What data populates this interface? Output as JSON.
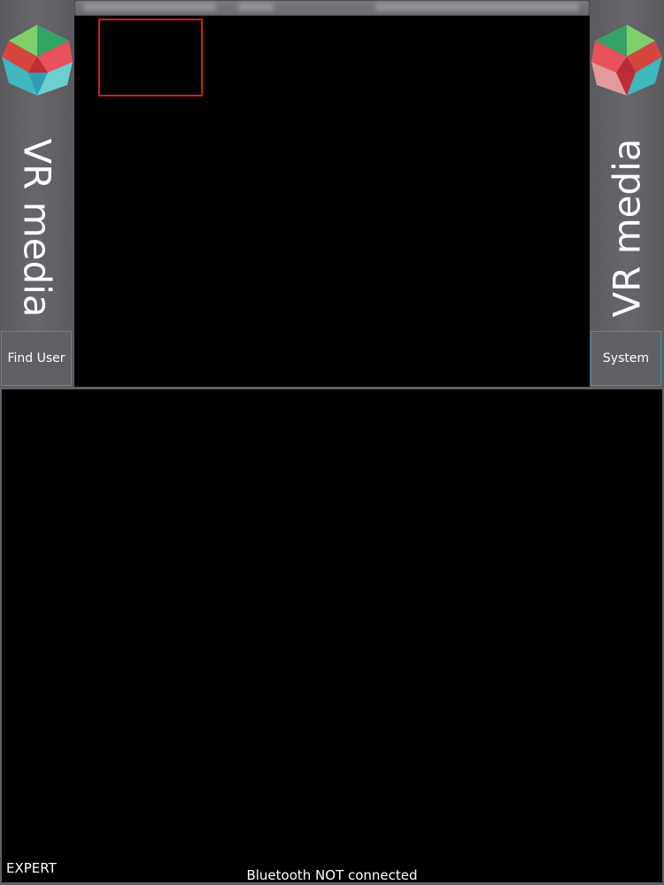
{
  "sidebar_left": {
    "brand_text": "VR media",
    "button_label": "Find User"
  },
  "sidebar_right": {
    "brand_text": "VR media",
    "button_label": "System"
  },
  "footer": {
    "mode_label": "EXPERT",
    "bluetooth_status": "Bluetooth NOT connected"
  },
  "colors": {
    "panel_gray": "#5e5e63",
    "selection_red": "#d41a1a",
    "button_border": "#4c8fa8",
    "background": "#000000",
    "text": "#ffffff"
  },
  "icons": {
    "logo": "cube-logo-icon"
  }
}
